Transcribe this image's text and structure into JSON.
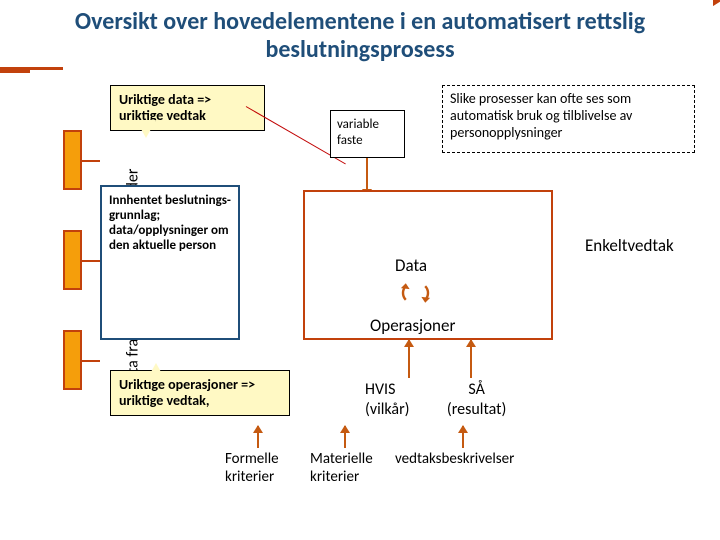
{
  "title": "Oversikt over hovedelementene i en automatisert rettslig beslutningsprosess",
  "sidebar_label": "Data fra interne og eksterne kilder",
  "callout_top": "Uriktige data => uriktige vedtak",
  "callout_bottom": "Uriktige operasjoner => uriktige vedtak,",
  "blue_box": "Innhentet beslutnings-grunnlag; data/opplysninger om den aktuelle person",
  "var_box_l1": "variable",
  "var_box_l2": "faste",
  "dashed_box": "Slike prosesser kan ofte ses som automatisk bruk og tilblivelse av personopplysninger",
  "data_label": "Data",
  "ops_label": "Operasjoner",
  "enkel_label": "Enkeltvedtak",
  "hvis": {
    "c1a": "HVIS",
    "c1b": "(vilkår)",
    "c2a": "SÅ",
    "c2b": "(resultat)"
  },
  "bottom": {
    "formelle": "Formelle kriterier",
    "materielle": "Materielle kriterier",
    "vedtaks": "vedtaksbeskrivelser"
  }
}
